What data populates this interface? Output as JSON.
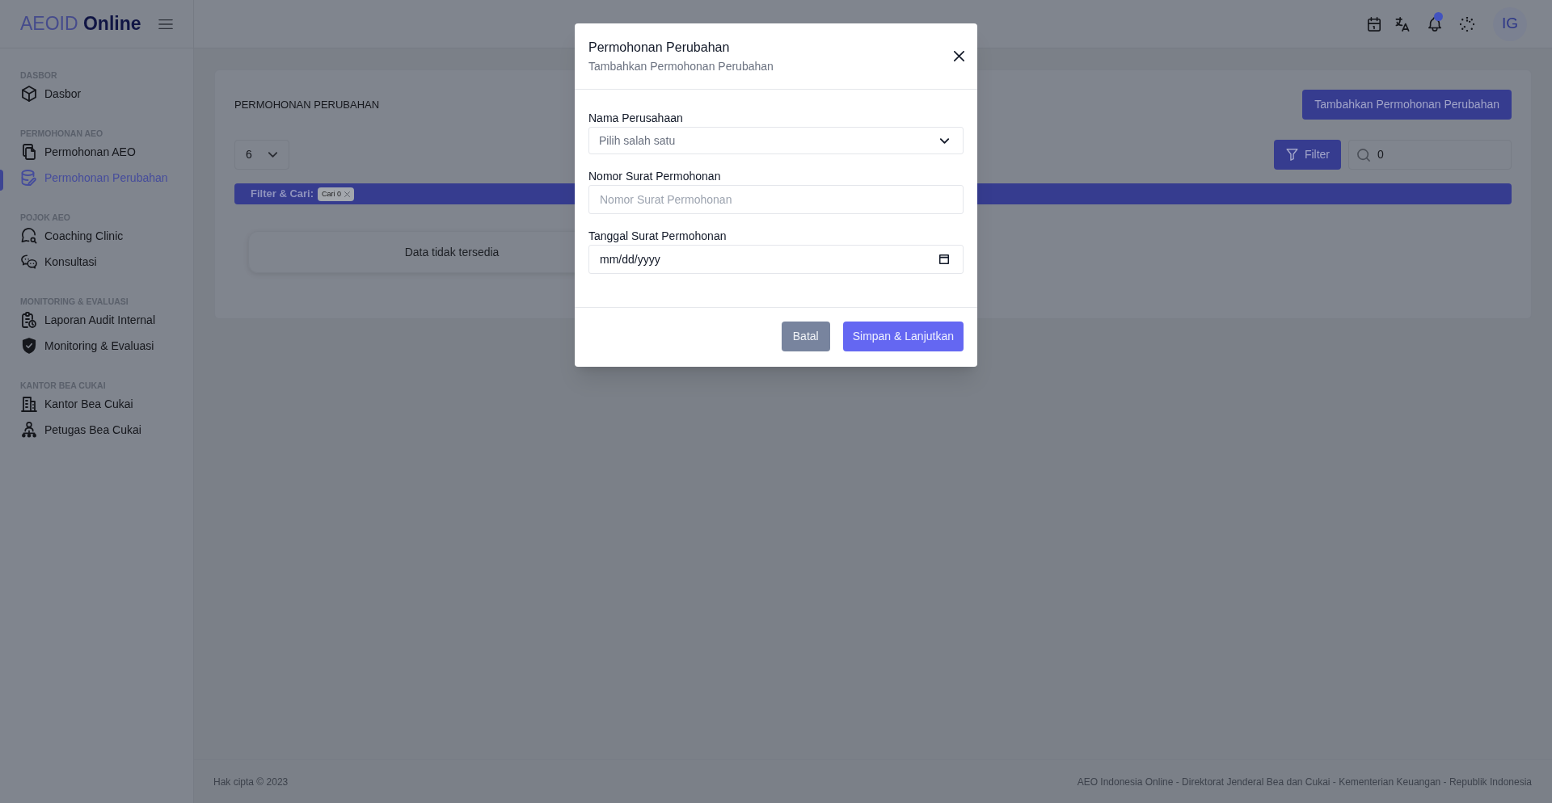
{
  "sidebar": {
    "logo": "AEOID **Online**",
    "sections": [
      {
        "title": "DASBOR",
        "items": [
          {
            "label": "Dasbor",
            "selected": false
          }
        ]
      },
      {
        "title": "PERMOHONAN AEO",
        "items": [
          {
            "label": "Permohonan AEO",
            "selected": false
          },
          {
            "label": "Permohonan Perubahan",
            "selected": true
          }
        ]
      },
      {
        "title": "POJOK AEO",
        "items": [
          {
            "label": "Coaching Clinic",
            "selected": false
          },
          {
            "label": "Konsultasi",
            "selected": false
          }
        ]
      },
      {
        "title": "MONITORING & EVALUASI",
        "items": [
          {
            "label": "Laporan Audit Internal",
            "selected": false
          },
          {
            "label": "Monitoring & Evaluasi",
            "selected": false
          }
        ]
      },
      {
        "title": "KANTOR BEA CUKAI",
        "items": [
          {
            "label": "Kantor Bea Cukai",
            "selected": false
          },
          {
            "label": "Petugas Bea Cukai",
            "selected": false
          }
        ]
      }
    ]
  },
  "header": {
    "notifications": {
      "unread": true
    },
    "avatar": {
      "initials": "IG"
    }
  },
  "page": {
    "title": "PERMOHONAN PERUBAHAN",
    "add_button": {
      "label": "Tambahkan Permohonan Perubahan"
    },
    "page_size": {
      "value": "6"
    },
    "filter_button": {
      "label": "Filter"
    },
    "search": {
      "value": "0"
    },
    "filter_bar": {
      "label": "Filter & Cari:",
      "chips": [
        {
          "label": "Cari 0"
        }
      ]
    },
    "empty_message": "Data tidak tersedia"
  },
  "modal": {
    "title": "Permohonan Perubahan",
    "subtitle": "Tambahkan Permohonan Perubahan",
    "fields": [
      {
        "kind": "select",
        "label": "Nama Perusahaan",
        "placeholder": "Pilih salah satu"
      },
      {
        "kind": "text",
        "label": "Nomor Surat Permohonan",
        "placeholder": "Nomor Surat Permohonan"
      },
      {
        "kind": "date",
        "label": "Tanggal Surat Permohonan",
        "placeholder": "mm/dd/yyyy"
      }
    ],
    "buttons": [
      {
        "kind": "secondary",
        "label": "Batal"
      },
      {
        "kind": "primary",
        "label": "Simpan & Lanjutkan"
      }
    ]
  },
  "footer": {
    "copyright": "Hak cipta © 2023",
    "credits": "AEO Indonesia Online - Direktorat Jenderal Bea dan Cukai - Kementerian Keuangan - Republik Indonesia"
  }
}
